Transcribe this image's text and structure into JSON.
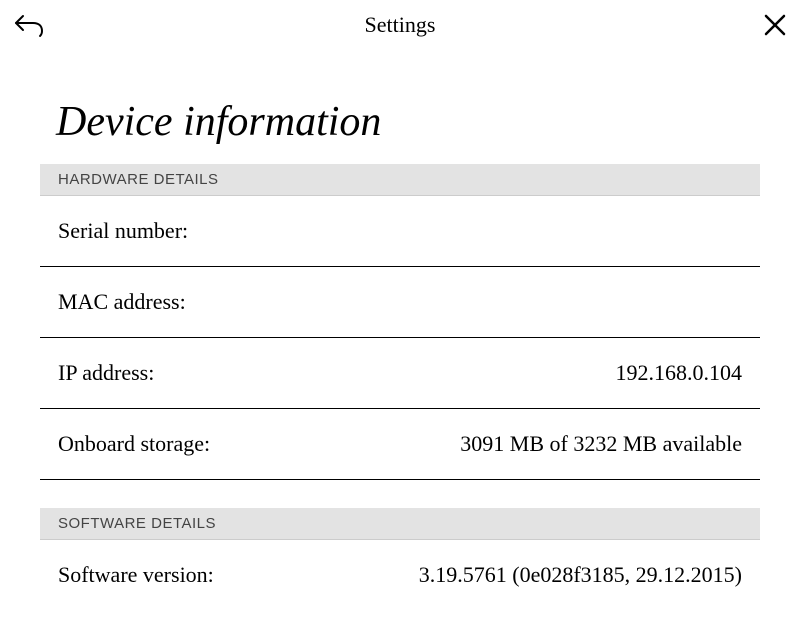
{
  "header": {
    "title": "Settings"
  },
  "page": {
    "title": "Device information"
  },
  "sections": {
    "hardware": {
      "header": "HARDWARE DETAILS",
      "serial_label": "Serial number:",
      "serial_value": "",
      "mac_label": "MAC address:",
      "mac_value": "",
      "ip_label": "IP address:",
      "ip_value": "192.168.0.104",
      "storage_label": "Onboard storage:",
      "storage_value": "3091 MB of 3232 MB available"
    },
    "software": {
      "header": "SOFTWARE DETAILS",
      "version_label": "Software version:",
      "version_value": "3.19.5761 (0e028f3185, 29.12.2015)"
    }
  }
}
